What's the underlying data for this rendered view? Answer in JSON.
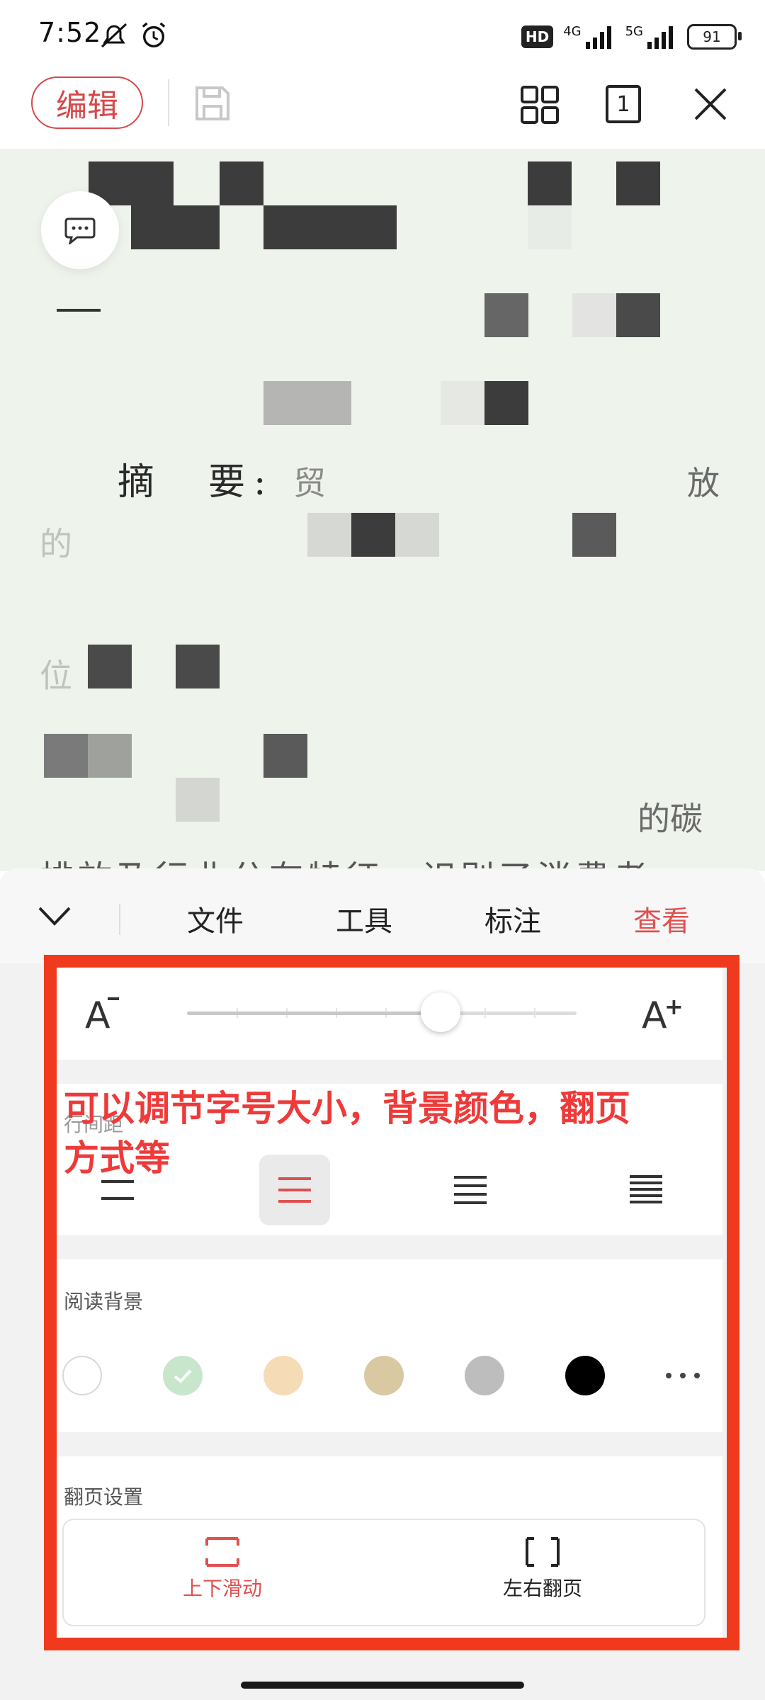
{
  "status_bar": {
    "time": "7:52",
    "hd_badge": "HD",
    "network_1": "4G",
    "network_2": "5G",
    "battery": "91"
  },
  "toolbar": {
    "edit_label": "编辑",
    "page_number": "1"
  },
  "document": {
    "abstract_label": "摘　要:",
    "text_fragment_1": "贸",
    "text_fragment_2": "放",
    "text_fragment_3": "的",
    "text_fragment_4": "位",
    "text_fragment_5": "的碳",
    "text_line_partial": "排放及行业分布特征，识别了消费者"
  },
  "tabs": [
    {
      "label": "文件",
      "active": false
    },
    {
      "label": "工具",
      "active": false
    },
    {
      "label": "标注",
      "active": false
    },
    {
      "label": "查看",
      "active": true
    }
  ],
  "font_size": {
    "decrease_label": "A",
    "increase_label": "A",
    "slider_value": 0.65
  },
  "line_spacing": {
    "label": "行间距",
    "selected_index": 1
  },
  "annotation": {
    "line1": "可以调节字号大小，背景颜色，翻页",
    "line2": "方式等"
  },
  "reading_background": {
    "label": "阅读背景",
    "swatches": [
      "#ffffff",
      "#c8e6cc",
      "#f6dcb6",
      "#d8c9a2",
      "#bdbdbd",
      "#000000"
    ],
    "selected_index": 1
  },
  "page_setting": {
    "label": "翻页设置",
    "options": [
      {
        "label": "上下滑动",
        "active": true
      },
      {
        "label": "左右翻页",
        "active": false
      }
    ]
  },
  "colors": {
    "accent": "#e0504f",
    "annotation_frame": "#f03a1e"
  }
}
